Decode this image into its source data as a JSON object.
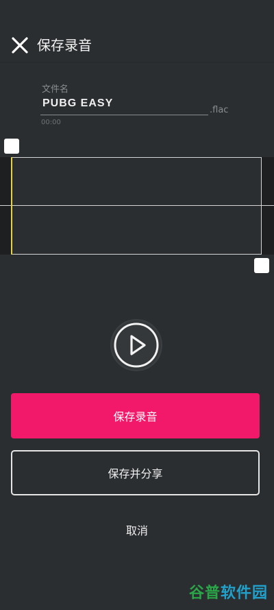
{
  "header": {
    "title": "保存录音",
    "close_icon": "close-icon"
  },
  "file": {
    "name_label": "文件名",
    "name_value": "PUBG EASY",
    "extension": ".flac",
    "duration": "00:00"
  },
  "waveform": {
    "playhead_color": "#e8d24a"
  },
  "player": {
    "play_icon": "play-icon"
  },
  "actions": {
    "save_label": "保存录音",
    "save_share_label": "保存并分享",
    "cancel_label": "取消"
  },
  "colors": {
    "accent": "#f2186a",
    "background": "#2b2e31"
  },
  "watermark": {
    "part1": "谷普",
    "part2": "软件园"
  }
}
